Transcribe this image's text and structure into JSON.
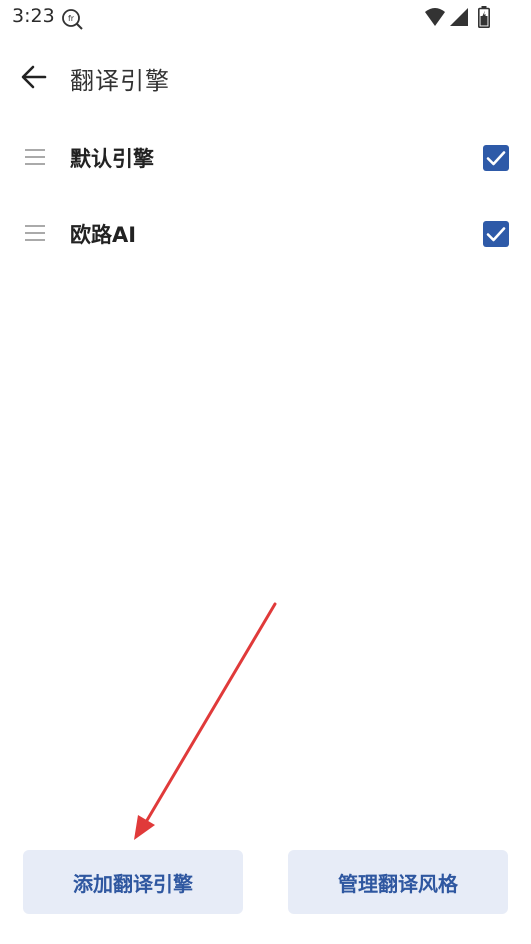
{
  "status_bar": {
    "time": "3:23",
    "app_icon": "translate-search-icon",
    "icons": [
      "wifi-icon",
      "signal-icon",
      "battery-icon"
    ]
  },
  "header": {
    "back_icon": "arrow-left-icon",
    "title": "翻译引擎"
  },
  "engines": [
    {
      "label": "默认引擎",
      "checked": true,
      "handle_icon": "drag-handle-icon"
    },
    {
      "label": "欧路AI",
      "checked": true,
      "handle_icon": "drag-handle-icon"
    }
  ],
  "footer": {
    "add_label": "添加翻译引擎",
    "manage_label": "管理翻译风格"
  },
  "colors": {
    "accent": "#2e5aa8",
    "button_bg": "#e7ecf7",
    "button_text": "#2f57a0",
    "annotation_arrow": "#e03a3a"
  }
}
